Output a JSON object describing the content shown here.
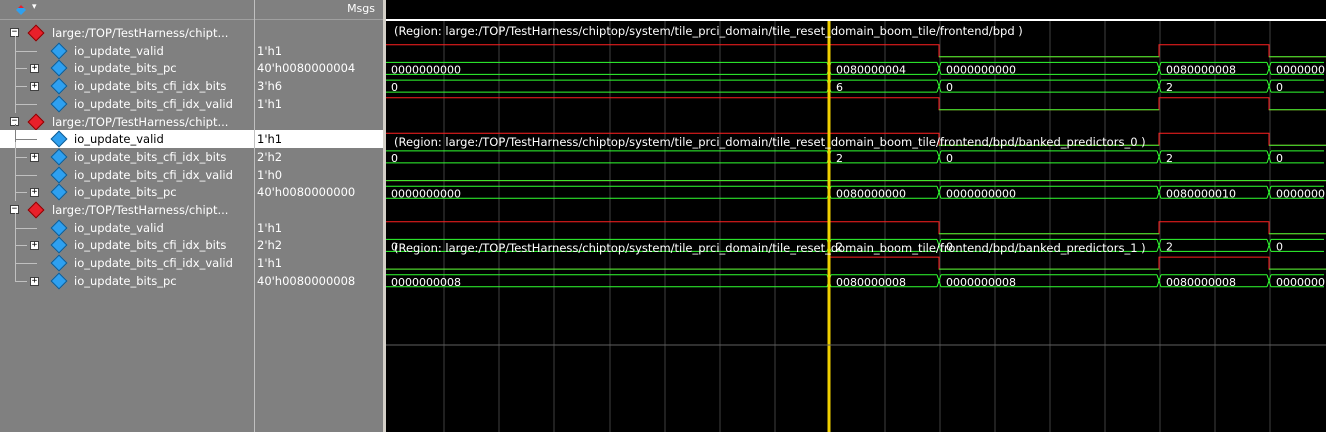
{
  "header": {
    "values_title": "Msgs"
  },
  "rows": [
    {
      "type": "group",
      "label": "large:/TOP/TestHarness/chipt...",
      "value": ""
    },
    {
      "type": "signal",
      "expandable": false,
      "label": "io_update_valid",
      "value": "1'h1"
    },
    {
      "type": "signal",
      "expandable": true,
      "label": "io_update_bits_pc",
      "value": "40'h0080000004"
    },
    {
      "type": "signal",
      "expandable": true,
      "label": "io_update_bits_cfi_idx_bits",
      "value": "3'h6"
    },
    {
      "type": "signal",
      "expandable": false,
      "label": "io_update_bits_cfi_idx_valid",
      "value": "1'h1"
    },
    {
      "type": "group",
      "label": "large:/TOP/TestHarness/chipt...",
      "value": ""
    },
    {
      "type": "signal",
      "expandable": false,
      "label": "io_update_valid",
      "value": "1'h1",
      "selected": true
    },
    {
      "type": "signal",
      "expandable": true,
      "label": "io_update_bits_cfi_idx_bits",
      "value": "2'h2"
    },
    {
      "type": "signal",
      "expandable": false,
      "label": "io_update_bits_cfi_idx_valid",
      "value": "1'h0"
    },
    {
      "type": "signal",
      "expandable": true,
      "label": "io_update_bits_pc",
      "value": "40'h0080000000"
    },
    {
      "type": "group",
      "label": "large:/TOP/TestHarness/chipt...",
      "value": ""
    },
    {
      "type": "signal",
      "expandable": false,
      "label": "io_update_valid",
      "value": "1'h1"
    },
    {
      "type": "signal",
      "expandable": true,
      "label": "io_update_bits_cfi_idx_bits",
      "value": "2'h2"
    },
    {
      "type": "signal",
      "expandable": false,
      "label": "io_update_bits_cfi_idx_valid",
      "value": "1'h1"
    },
    {
      "type": "signal",
      "expandable": true,
      "label": "io_update_bits_pc",
      "value": "40'h0080000008"
    }
  ],
  "regions": [
    "(Region: large:/TOP/TestHarness/chiptop/system/tile_prci_domain/tile_reset_domain_boom_tile/frontend/bpd )",
    "(Region: large:/TOP/TestHarness/chiptop/system/tile_prci_domain/tile_reset_domain_boom_tile/frontend/bpd/banked_predictors_0 )",
    "(Region: large:/TOP/TestHarness/chiptop/system/tile_prci_domain/tile_reset_domain_boom_tile/frontend/bpd/banked_predictors_1 )"
  ],
  "waves": {
    "r1": {
      "kind": "bit"
    },
    "r2": {
      "kind": "bus",
      "labels": [
        "0000000000",
        "0080000004",
        "0000000000",
        "0080000008",
        "0000000"
      ]
    },
    "r3": {
      "kind": "bus",
      "labels": [
        "0",
        "6",
        "0",
        "2",
        "0"
      ]
    },
    "r4": {
      "kind": "bit"
    },
    "r6": {
      "kind": "bit"
    },
    "r7": {
      "kind": "bus",
      "labels": [
        "0",
        "2",
        "0",
        "2",
        "0"
      ]
    },
    "r8": {
      "kind": "bit"
    },
    "r9": {
      "kind": "bus",
      "labels": [
        "0000000000",
        "0080000000",
        "0000000000",
        "0080000010",
        "0000000"
      ]
    },
    "r11": {
      "kind": "bit"
    },
    "r12": {
      "kind": "bus",
      "labels": [
        "0",
        "2",
        "0",
        "2",
        "0"
      ]
    },
    "r13": {
      "kind": "bit"
    },
    "r14": {
      "kind": "bus",
      "labels": [
        "0000000008",
        "0080000008",
        "0000000008",
        "0080000008",
        "0000000"
      ]
    }
  },
  "colors": {
    "high": "#ff2020",
    "low": "#30ff30",
    "bus": "#30ff30",
    "cursor": "#f0d000",
    "grid": "#404040"
  }
}
